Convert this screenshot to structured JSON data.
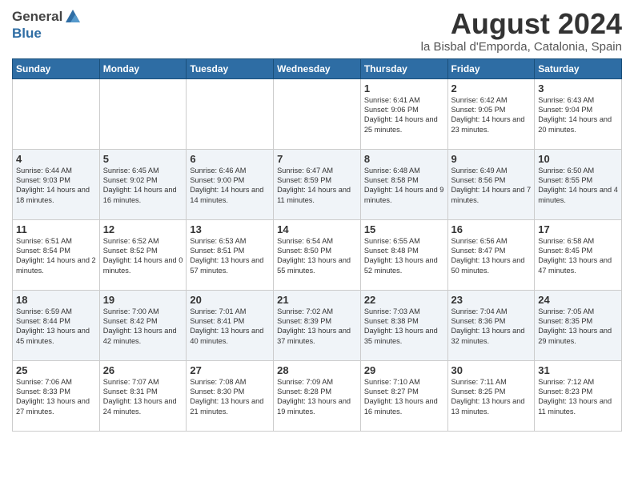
{
  "header": {
    "logo_general": "General",
    "logo_blue": "Blue",
    "title": "August 2024",
    "subtitle": "la Bisbal d'Emporda, Catalonia, Spain"
  },
  "calendar": {
    "days_of_week": [
      "Sunday",
      "Monday",
      "Tuesday",
      "Wednesday",
      "Thursday",
      "Friday",
      "Saturday"
    ],
    "weeks": [
      [
        {
          "day": "",
          "content": ""
        },
        {
          "day": "",
          "content": ""
        },
        {
          "day": "",
          "content": ""
        },
        {
          "day": "",
          "content": ""
        },
        {
          "day": "1",
          "content": "Sunrise: 6:41 AM\nSunset: 9:06 PM\nDaylight: 14 hours\nand 25 minutes."
        },
        {
          "day": "2",
          "content": "Sunrise: 6:42 AM\nSunset: 9:05 PM\nDaylight: 14 hours\nand 23 minutes."
        },
        {
          "day": "3",
          "content": "Sunrise: 6:43 AM\nSunset: 9:04 PM\nDaylight: 14 hours\nand 20 minutes."
        }
      ],
      [
        {
          "day": "4",
          "content": "Sunrise: 6:44 AM\nSunset: 9:03 PM\nDaylight: 14 hours\nand 18 minutes."
        },
        {
          "day": "5",
          "content": "Sunrise: 6:45 AM\nSunset: 9:02 PM\nDaylight: 14 hours\nand 16 minutes."
        },
        {
          "day": "6",
          "content": "Sunrise: 6:46 AM\nSunset: 9:00 PM\nDaylight: 14 hours\nand 14 minutes."
        },
        {
          "day": "7",
          "content": "Sunrise: 6:47 AM\nSunset: 8:59 PM\nDaylight: 14 hours\nand 11 minutes."
        },
        {
          "day": "8",
          "content": "Sunrise: 6:48 AM\nSunset: 8:58 PM\nDaylight: 14 hours\nand 9 minutes."
        },
        {
          "day": "9",
          "content": "Sunrise: 6:49 AM\nSunset: 8:56 PM\nDaylight: 14 hours\nand 7 minutes."
        },
        {
          "day": "10",
          "content": "Sunrise: 6:50 AM\nSunset: 8:55 PM\nDaylight: 14 hours\nand 4 minutes."
        }
      ],
      [
        {
          "day": "11",
          "content": "Sunrise: 6:51 AM\nSunset: 8:54 PM\nDaylight: 14 hours\nand 2 minutes."
        },
        {
          "day": "12",
          "content": "Sunrise: 6:52 AM\nSunset: 8:52 PM\nDaylight: 14 hours\nand 0 minutes."
        },
        {
          "day": "13",
          "content": "Sunrise: 6:53 AM\nSunset: 8:51 PM\nDaylight: 13 hours\nand 57 minutes."
        },
        {
          "day": "14",
          "content": "Sunrise: 6:54 AM\nSunset: 8:50 PM\nDaylight: 13 hours\nand 55 minutes."
        },
        {
          "day": "15",
          "content": "Sunrise: 6:55 AM\nSunset: 8:48 PM\nDaylight: 13 hours\nand 52 minutes."
        },
        {
          "day": "16",
          "content": "Sunrise: 6:56 AM\nSunset: 8:47 PM\nDaylight: 13 hours\nand 50 minutes."
        },
        {
          "day": "17",
          "content": "Sunrise: 6:58 AM\nSunset: 8:45 PM\nDaylight: 13 hours\nand 47 minutes."
        }
      ],
      [
        {
          "day": "18",
          "content": "Sunrise: 6:59 AM\nSunset: 8:44 PM\nDaylight: 13 hours\nand 45 minutes."
        },
        {
          "day": "19",
          "content": "Sunrise: 7:00 AM\nSunset: 8:42 PM\nDaylight: 13 hours\nand 42 minutes."
        },
        {
          "day": "20",
          "content": "Sunrise: 7:01 AM\nSunset: 8:41 PM\nDaylight: 13 hours\nand 40 minutes."
        },
        {
          "day": "21",
          "content": "Sunrise: 7:02 AM\nSunset: 8:39 PM\nDaylight: 13 hours\nand 37 minutes."
        },
        {
          "day": "22",
          "content": "Sunrise: 7:03 AM\nSunset: 8:38 PM\nDaylight: 13 hours\nand 35 minutes."
        },
        {
          "day": "23",
          "content": "Sunrise: 7:04 AM\nSunset: 8:36 PM\nDaylight: 13 hours\nand 32 minutes."
        },
        {
          "day": "24",
          "content": "Sunrise: 7:05 AM\nSunset: 8:35 PM\nDaylight: 13 hours\nand 29 minutes."
        }
      ],
      [
        {
          "day": "25",
          "content": "Sunrise: 7:06 AM\nSunset: 8:33 PM\nDaylight: 13 hours\nand 27 minutes."
        },
        {
          "day": "26",
          "content": "Sunrise: 7:07 AM\nSunset: 8:31 PM\nDaylight: 13 hours\nand 24 minutes."
        },
        {
          "day": "27",
          "content": "Sunrise: 7:08 AM\nSunset: 8:30 PM\nDaylight: 13 hours\nand 21 minutes."
        },
        {
          "day": "28",
          "content": "Sunrise: 7:09 AM\nSunset: 8:28 PM\nDaylight: 13 hours\nand 19 minutes."
        },
        {
          "day": "29",
          "content": "Sunrise: 7:10 AM\nSunset: 8:27 PM\nDaylight: 13 hours\nand 16 minutes."
        },
        {
          "day": "30",
          "content": "Sunrise: 7:11 AM\nSunset: 8:25 PM\nDaylight: 13 hours\nand 13 minutes."
        },
        {
          "day": "31",
          "content": "Sunrise: 7:12 AM\nSunset: 8:23 PM\nDaylight: 13 hours\nand 11 minutes."
        }
      ]
    ]
  }
}
